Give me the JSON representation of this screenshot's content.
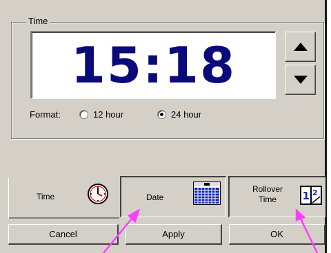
{
  "time_group": {
    "title": "Time",
    "display": "15:18",
    "format_label": "Format:",
    "options": [
      {
        "label": "12 hour",
        "selected": false
      },
      {
        "label": "24 hour",
        "selected": true
      }
    ]
  },
  "tabs": [
    {
      "label_lines": [
        "Time"
      ],
      "icon": "clock-icon"
    },
    {
      "label_lines": [
        "Date"
      ],
      "icon": "calendar-icon"
    },
    {
      "label_lines": [
        "Rollover",
        "Time"
      ],
      "icon": "rollover-icon"
    }
  ],
  "buttons": {
    "cancel": "Cancel",
    "apply": "Apply",
    "ok": "OK"
  },
  "colors": {
    "time_text": "#0a0a7a",
    "calendar": "#1428b4",
    "arrow": "#ff3cff",
    "clock_hand": "#cc0000"
  }
}
